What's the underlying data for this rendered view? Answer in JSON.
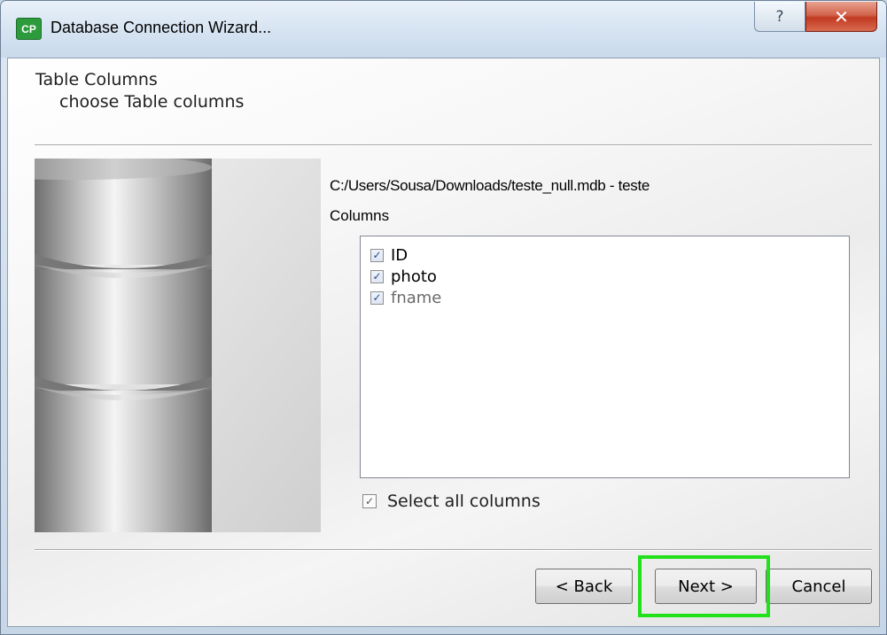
{
  "window": {
    "title": "Database Connection Wizard...",
    "app_icon_text": "CP",
    "help_label": "?",
    "close_label": "✕"
  },
  "page": {
    "title": "Table Columns",
    "subtitle": "choose Table columns"
  },
  "source": {
    "path": "C:/Users/Sousa/Downloads/teste_null.mdb - teste"
  },
  "columns": {
    "label": "Columns",
    "items": [
      {
        "name": "ID",
        "checked": true
      },
      {
        "name": "photo",
        "checked": true
      },
      {
        "name": "fname",
        "checked": true
      }
    ]
  },
  "select_all": {
    "label": "Select all columns",
    "checked": true
  },
  "buttons": {
    "back": "< Back",
    "next": "Next >",
    "cancel": "Cancel"
  },
  "colors": {
    "highlight": "#22e01a",
    "item_text_active": "#000000",
    "item_text_muted": "#6a6a6a"
  }
}
